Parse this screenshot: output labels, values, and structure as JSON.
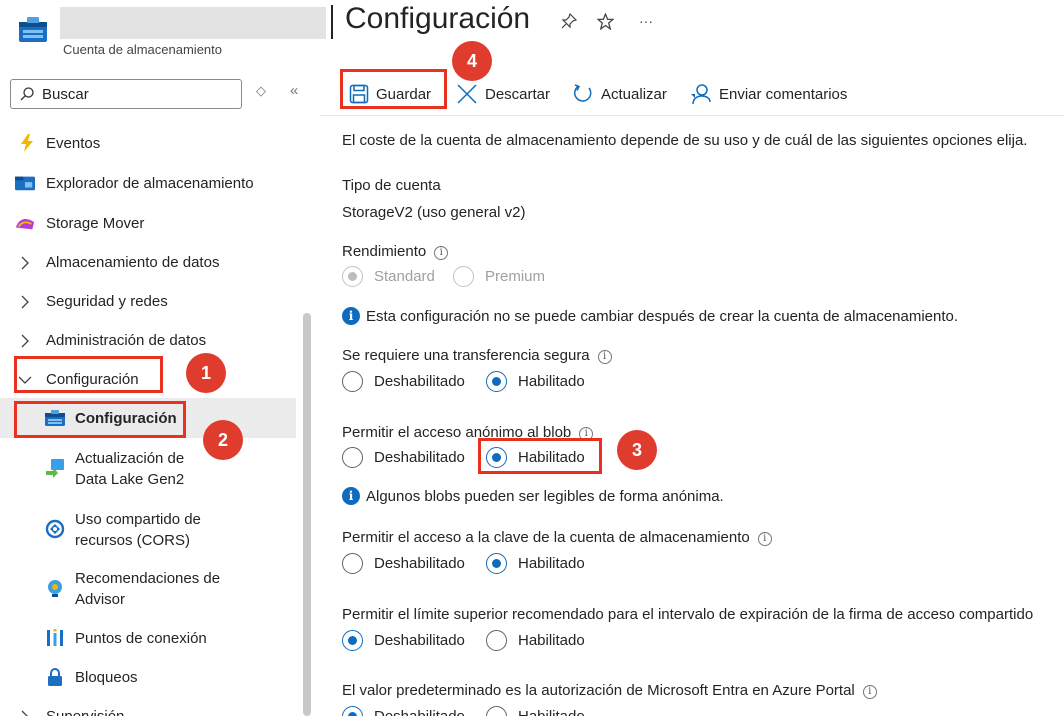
{
  "header": {
    "title": "Configuración",
    "subtitle": "Cuenta de almacenamiento",
    "more": "···"
  },
  "sidebar": {
    "search_placeholder": "Buscar",
    "items": [
      {
        "label": "Eventos"
      },
      {
        "label": "Explorador de almacenamiento"
      },
      {
        "label": "Storage Mover"
      },
      {
        "label": "Almacenamiento de datos"
      },
      {
        "label": "Seguridad y redes"
      },
      {
        "label": "Administración de datos"
      },
      {
        "label": "Configuración"
      },
      {
        "label": "Configuración"
      },
      {
        "label": "Actualización de",
        "label2": "Data Lake Gen2"
      },
      {
        "label": "Uso compartido de",
        "label2": "recursos (CORS)"
      },
      {
        "label": "Recomendaciones de",
        "label2": "Advisor"
      },
      {
        "label": "Puntos de conexión"
      },
      {
        "label": "Bloqueos"
      },
      {
        "label": "Supervisión"
      }
    ]
  },
  "toolbar": {
    "save": "Guardar",
    "discard": "Descartar",
    "refresh": "Actualizar",
    "feedback": "Enviar comentarios"
  },
  "badges": [
    "1",
    "2",
    "3",
    "4"
  ],
  "main": {
    "intro": "El coste de la cuenta de almacenamiento depende de su uso y de cuál de las siguientes opciones elija.",
    "account_type_label": "Tipo de cuenta",
    "account_type_value": "StorageV2 (uso general v2)",
    "performance_label": "Rendimiento",
    "perf_standard": "Standard",
    "perf_premium": "Premium",
    "perf_info": "Esta configuración no se puede cambiar después de crear la cuenta de almacenamiento.",
    "secure_transfer_label": "Se requiere una transferencia segura",
    "blob_anon_label": "Permitir el acceso anónimo al blob",
    "blob_info": "Algunos blobs pueden ser legibles de forma anónima.",
    "key_access_label": "Permitir el acceso a la clave de la cuenta de almacenamiento",
    "sas_limit_label": "Permitir el límite superior recomendado para el intervalo de expiración de la firma de acceso compartido",
    "entra_default_label": "El valor predeterminado es la autorización de Microsoft Entra en Azure Portal",
    "disabled": "Deshabilitado",
    "enabled": "Habilitado"
  }
}
